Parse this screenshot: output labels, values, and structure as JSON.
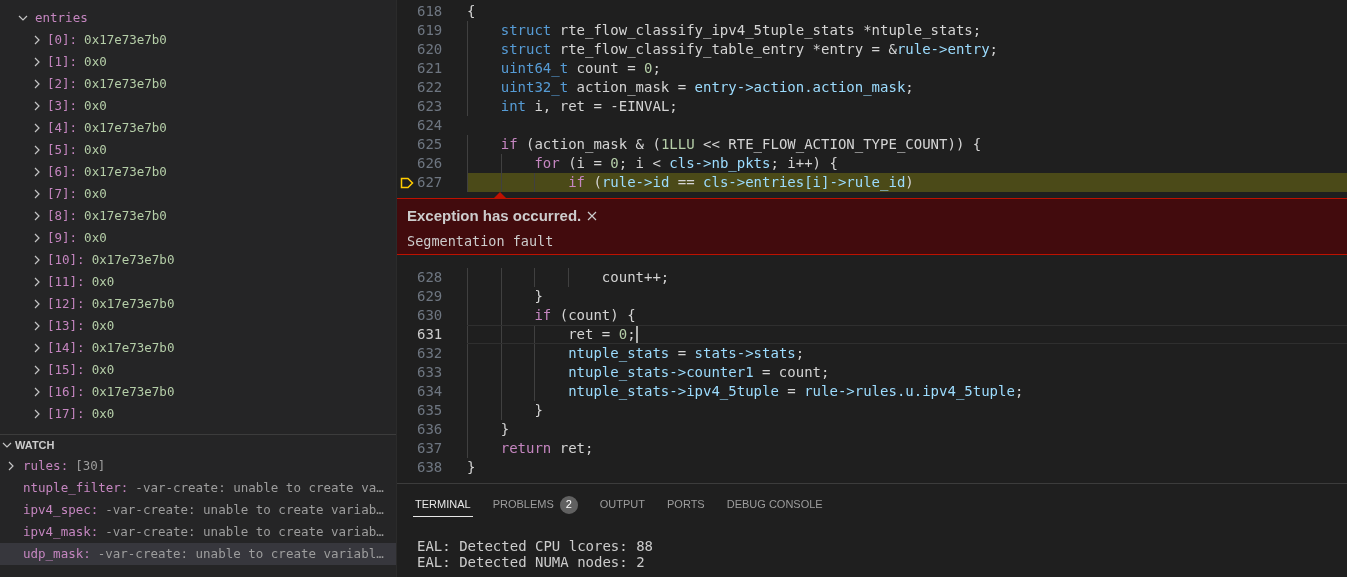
{
  "variables": {
    "label": "entries",
    "expanded": true,
    "children": [
      {
        "name": "[0]:",
        "value": "0x17e73e7b0",
        "expanded": false
      },
      {
        "name": "[1]:",
        "value": "0x0",
        "expanded": false
      },
      {
        "name": "[2]:",
        "value": "0x17e73e7b0",
        "expanded": false
      },
      {
        "name": "[3]:",
        "value": "0x0",
        "expanded": false
      },
      {
        "name": "[4]:",
        "value": "0x17e73e7b0",
        "expanded": false
      },
      {
        "name": "[5]:",
        "value": "0x0",
        "expanded": false
      },
      {
        "name": "[6]:",
        "value": "0x17e73e7b0",
        "expanded": false
      },
      {
        "name": "[7]:",
        "value": "0x0",
        "expanded": false
      },
      {
        "name": "[8]:",
        "value": "0x17e73e7b0",
        "expanded": false
      },
      {
        "name": "[9]:",
        "value": "0x0",
        "expanded": false
      },
      {
        "name": "[10]:",
        "value": "0x17e73e7b0",
        "expanded": false
      },
      {
        "name": "[11]:",
        "value": "0x0",
        "expanded": false
      },
      {
        "name": "[12]:",
        "value": "0x17e73e7b0",
        "expanded": false
      },
      {
        "name": "[13]:",
        "value": "0x0",
        "expanded": false
      },
      {
        "name": "[14]:",
        "value": "0x17e73e7b0",
        "expanded": false
      },
      {
        "name": "[15]:",
        "value": "0x0",
        "expanded": false
      },
      {
        "name": "[16]:",
        "value": "0x17e73e7b0",
        "expanded": false
      },
      {
        "name": "[17]:",
        "value": "0x0",
        "expanded": false
      }
    ]
  },
  "watch": {
    "title": "WATCH",
    "expanded": true,
    "items": [
      {
        "kind": "expandable",
        "name": "rules:",
        "value": "[30]",
        "expanded": false,
        "selected": false
      },
      {
        "kind": "leaf",
        "name": "ntuple_filter:",
        "value": "-var-create: unable to create va…",
        "selected": false
      },
      {
        "kind": "leaf",
        "name": "ipv4_spec:",
        "value": "-var-create: unable to create variab…",
        "selected": false
      },
      {
        "kind": "leaf",
        "name": "ipv4_mask:",
        "value": "-var-create: unable to create variab…",
        "selected": false
      },
      {
        "kind": "leaf",
        "name": "udp_mask:",
        "value": "-var-create: unable to create variabl…",
        "selected": true
      }
    ]
  },
  "editor": {
    "lines": [
      {
        "number": "618",
        "paused": false,
        "cursor": false,
        "tokens": [
          {
            "kind": "plain",
            "text": "{"
          }
        ]
      },
      {
        "number": "619",
        "paused": false,
        "cursor": false,
        "tokens": [
          {
            "kind": "type",
            "text": "    struct"
          },
          {
            "kind": "plain",
            "text": " rte_flow_classify_ipv4_5tuple_stats *ntuple_stats;"
          }
        ]
      },
      {
        "number": "620",
        "paused": false,
        "cursor": false,
        "tokens": [
          {
            "kind": "type",
            "text": "    struct"
          },
          {
            "kind": "plain",
            "text": " rte_flow_classify_table_entry *entry = &"
          },
          {
            "kind": "var",
            "text": "rule->entry"
          },
          {
            "kind": "plain",
            "text": ";"
          }
        ]
      },
      {
        "number": "621",
        "paused": false,
        "cursor": false,
        "tokens": [
          {
            "kind": "type",
            "text": "    uint64_t"
          },
          {
            "kind": "plain",
            "text": " count = "
          },
          {
            "kind": "num",
            "text": "0"
          },
          {
            "kind": "plain",
            "text": ";"
          }
        ]
      },
      {
        "number": "622",
        "paused": false,
        "cursor": false,
        "tokens": [
          {
            "kind": "type",
            "text": "    uint32_t"
          },
          {
            "kind": "plain",
            "text": " action_mask = "
          },
          {
            "kind": "var",
            "text": "entry->action.action_mask"
          },
          {
            "kind": "plain",
            "text": ";"
          }
        ]
      },
      {
        "number": "623",
        "paused": false,
        "cursor": false,
        "tokens": [
          {
            "kind": "type",
            "text": "    int"
          },
          {
            "kind": "plain",
            "text": " i, ret = -EINVAL;"
          }
        ]
      },
      {
        "number": "624",
        "paused": false,
        "cursor": false
      },
      {
        "number": "625",
        "paused": false,
        "cursor": false,
        "tokens": [
          {
            "kind": "control",
            "text": "    if"
          },
          {
            "kind": "plain",
            "text": " (action_mask & ("
          },
          {
            "kind": "num",
            "text": "1LLU"
          },
          {
            "kind": "plain",
            "text": " << RTE_FLOW_ACTION_TYPE_COUNT)) {"
          }
        ]
      },
      {
        "number": "626",
        "paused": false,
        "cursor": false,
        "tokens": [
          {
            "kind": "control",
            "text": "        for"
          },
          {
            "kind": "plain",
            "text": " (i = "
          },
          {
            "kind": "num",
            "text": "0"
          },
          {
            "kind": "plain",
            "text": "; i < "
          },
          {
            "kind": "var",
            "text": "cls->nb_pkts"
          },
          {
            "kind": "plain",
            "text": "; i++) {"
          }
        ]
      },
      {
        "number": "627",
        "paused": true,
        "cursor": false,
        "tokens": [
          {
            "kind": "control",
            "text": "            if"
          },
          {
            "kind": "plain",
            "text": " ("
          },
          {
            "kind": "var",
            "text": "rule->id"
          },
          {
            "kind": "plain",
            "text": " == "
          },
          {
            "kind": "var",
            "text": "cls->entries[i]->rule_id"
          },
          {
            "kind": "plain",
            "text": ")"
          }
        ]
      },
      {
        "number": "628",
        "paused": false,
        "cursor": false,
        "tokens": [
          {
            "kind": "plain",
            "text": "                count++;"
          }
        ]
      },
      {
        "number": "629",
        "paused": false,
        "cursor": false,
        "tokens": [
          {
            "kind": "plain",
            "text": "        }"
          }
        ]
      },
      {
        "number": "630",
        "paused": false,
        "cursor": false,
        "tokens": [
          {
            "kind": "control",
            "text": "        if"
          },
          {
            "kind": "plain",
            "text": " (count) {"
          }
        ]
      },
      {
        "number": "631",
        "paused": false,
        "cursor": true,
        "tokens": [
          {
            "kind": "plain",
            "text": "            ret = "
          },
          {
            "kind": "num",
            "text": "0"
          },
          {
            "kind": "plain",
            "text": ";"
          }
        ]
      },
      {
        "number": "632",
        "paused": false,
        "cursor": false,
        "tokens": [
          {
            "kind": "var",
            "text": "            ntuple_stats"
          },
          {
            "kind": "plain",
            "text": " = "
          },
          {
            "kind": "var",
            "text": "stats->stats"
          },
          {
            "kind": "plain",
            "text": ";"
          }
        ]
      },
      {
        "number": "633",
        "paused": false,
        "cursor": false,
        "tokens": [
          {
            "kind": "var",
            "text": "            ntuple_stats->counter1"
          },
          {
            "kind": "plain",
            "text": " = count;"
          }
        ]
      },
      {
        "number": "634",
        "paused": false,
        "cursor": false,
        "tokens": [
          {
            "kind": "var",
            "text": "            ntuple_stats->ipv4_5tuple"
          },
          {
            "kind": "plain",
            "text": " = "
          },
          {
            "kind": "var",
            "text": "rule->rules.u.ipv4_5tuple"
          },
          {
            "kind": "plain",
            "text": ";"
          }
        ]
      },
      {
        "number": "635",
        "paused": false,
        "cursor": false,
        "tokens": [
          {
            "kind": "plain",
            "text": "        }"
          }
        ]
      },
      {
        "number": "636",
        "paused": false,
        "cursor": false,
        "tokens": [
          {
            "kind": "plain",
            "text": "    }"
          }
        ]
      },
      {
        "number": "637",
        "paused": false,
        "cursor": false,
        "tokens": [
          {
            "kind": "control",
            "text": "    return"
          },
          {
            "kind": "plain",
            "text": " ret;"
          }
        ]
      },
      {
        "number": "638",
        "paused": false,
        "cursor": false,
        "tokens": [
          {
            "kind": "plain",
            "text": "}"
          }
        ]
      }
    ],
    "exception": {
      "title": "Exception has occurred.",
      "message": "Segmentation fault"
    }
  },
  "panel": {
    "tabs": [
      {
        "label": "TERMINAL",
        "selected": true
      },
      {
        "label": "PROBLEMS",
        "badge": "2",
        "selected": false
      },
      {
        "label": "OUTPUT",
        "selected": false
      },
      {
        "label": "PORTS",
        "selected": false
      },
      {
        "label": "DEBUG CONSOLE",
        "selected": false
      }
    ],
    "terminal_lines": [
      "EAL: Detected CPU lcores: 88",
      "EAL: Detected NUMA nodes: 2"
    ]
  }
}
